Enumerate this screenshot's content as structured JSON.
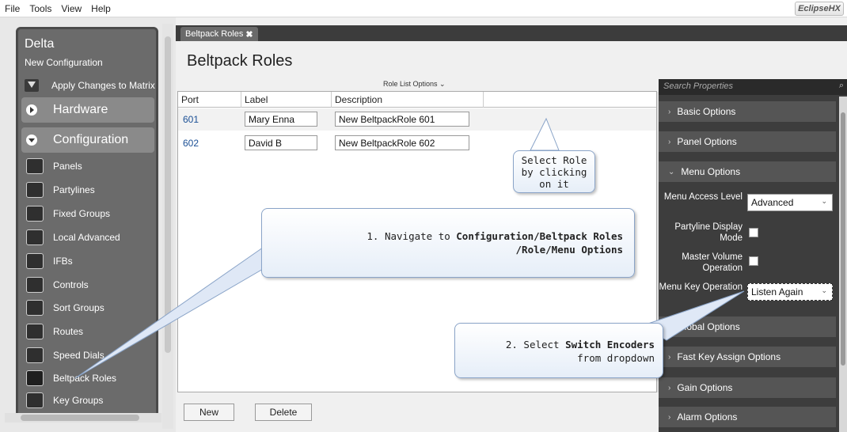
{
  "menubar": {
    "items": [
      "File",
      "Tools",
      "View",
      "Help"
    ],
    "brand": "EclipseHX"
  },
  "nav": {
    "title": "Delta",
    "subtitle": "New Configuration",
    "apply_label": "Apply Changes to Matrix",
    "hardware_label": "Hardware",
    "configuration_label": "Configuration",
    "items": [
      "Panels",
      "Partylines",
      "Fixed Groups",
      "Local Advanced",
      "IFBs",
      "Controls",
      "Sort Groups",
      "Routes",
      "Speed Dials",
      "Beltpack Roles",
      "Key Groups"
    ]
  },
  "tab": {
    "label": "Beltpack Roles",
    "close": "✖"
  },
  "page": {
    "title": "Beltpack Roles",
    "role_list_options": "Role List Options ⌄"
  },
  "grid": {
    "headers": [
      "Port",
      "Label",
      "Description"
    ],
    "rows": [
      {
        "port": "601",
        "label": "Mary Enna",
        "description": "New BeltpackRole 601"
      },
      {
        "port": "602",
        "label": "David B",
        "description": "New BeltpackRole 602"
      }
    ]
  },
  "buttons": {
    "new": "New",
    "delete": "Delete"
  },
  "properties": {
    "search_placeholder": "Search Properties",
    "sections": {
      "basic": "Basic Options",
      "panel": "Panel Options",
      "menu": "Menu Options",
      "global": "Global Options",
      "fast_key": "Fast Key Assign Options",
      "gain": "Gain Options",
      "alarm": "Alarm Options"
    },
    "menu_access_level_label": "Menu Access Level",
    "menu_access_level_value": "Advanced",
    "partyline_display_mode_label": "Partyline Display Mode",
    "master_volume_operation_label": "Master Volume Operation",
    "menu_key_operation_label": "Menu Key Operation",
    "menu_key_operation_value": "Listen Again"
  },
  "callouts": {
    "select_role": "Select Role by clicking on it",
    "step1_prefix": "1. Navigate to ",
    "step1_bold": "Configuration/Beltpack Roles /Role/Menu Options",
    "step2_prefix": "2. Select ",
    "step2_bold": "Switch Encoders",
    "step2_suffix": "from dropdown"
  }
}
